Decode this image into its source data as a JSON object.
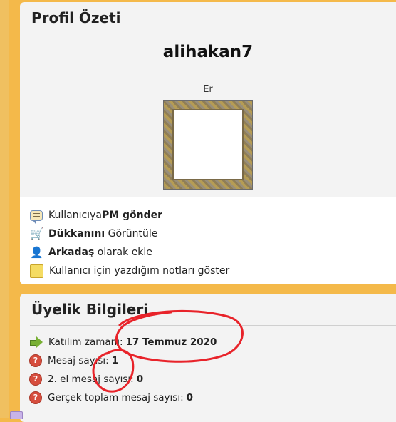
{
  "profile": {
    "title": "Profil Özeti",
    "username": "alihakan7",
    "gender": "Er"
  },
  "actions": [
    {
      "icon": "pm-bubble-icon",
      "prefix": "Kullanıcıya ",
      "bold": "PM gönder",
      "suffix": ""
    },
    {
      "icon": "shopping-cart-icon",
      "prefix": "",
      "bold": "Dükkanını",
      "suffix": " Görüntüle"
    },
    {
      "icon": "add-friend-icon",
      "prefix": "",
      "bold": "Arkadaş",
      "suffix": " olarak ekle"
    },
    {
      "icon": "sticky-note-icon",
      "prefix": "Kullanıcı için yazdığım notları göster",
      "bold": "",
      "suffix": ""
    }
  ],
  "membership": {
    "title": "Üyelik Bilgileri",
    "rows": [
      {
        "icon": "green-arrow-icon",
        "label": "Katılım zamanı:",
        "value": "17 Temmuz 2020"
      },
      {
        "icon": "question-icon",
        "label": "Mesaj sayısı:",
        "value": "1"
      },
      {
        "icon": "question-icon",
        "label": "2. el mesaj sayısı:",
        "value": "0"
      },
      {
        "icon": "question-icon",
        "label": "Gerçek toplam mesaj sayısı:",
        "value": "0"
      }
    ]
  },
  "colors": {
    "page_background": "#f4b94a",
    "card_background": "#f3f3f3",
    "annotation_red": "#e8232a"
  }
}
